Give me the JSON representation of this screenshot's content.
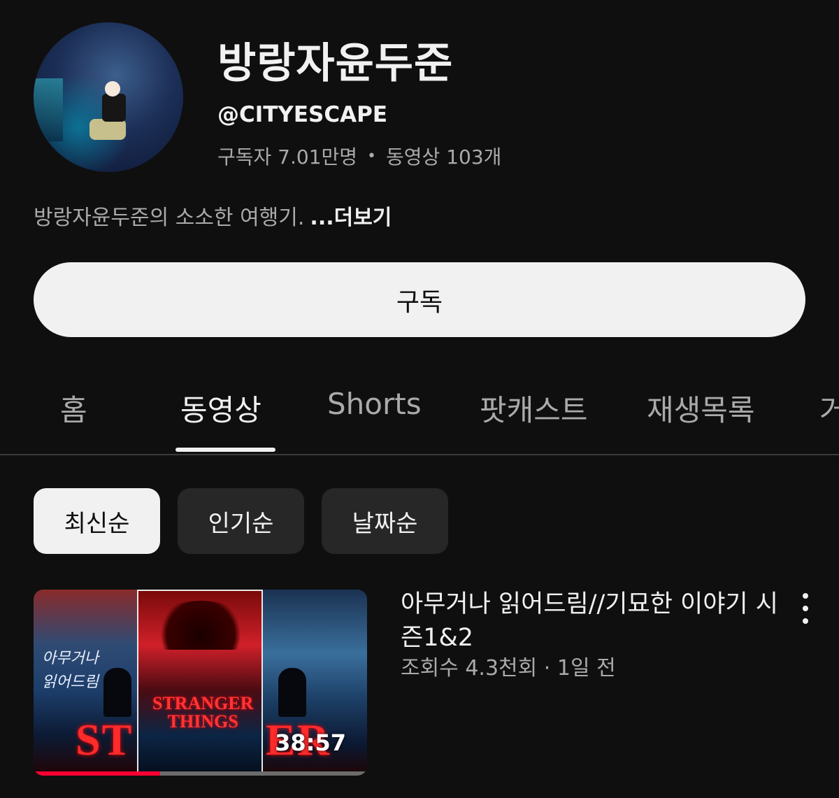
{
  "channel": {
    "name": "방랑자윤두준",
    "handle": "@CITYESCAPE",
    "subscribers": "구독자 7.01만명",
    "separator": "•",
    "video_count": "동영상 103개",
    "description": "방랑자윤두준의 소소한 여행기.",
    "more_label": "...더보기"
  },
  "subscribe_label": "구독",
  "tabs": [
    {
      "label": "홈"
    },
    {
      "label": "동영상"
    },
    {
      "label": "Shorts"
    },
    {
      "label": "팟캐스트"
    },
    {
      "label": "재생목록"
    },
    {
      "label": "거"
    }
  ],
  "active_tab": "동영상",
  "sort_chips": [
    {
      "label": "최신순"
    },
    {
      "label": "인기순"
    },
    {
      "label": "날짜순"
    }
  ],
  "active_chip": "최신순",
  "video": {
    "title": "아무거나 읽어드림//기묘한 이야기 시즌1&2",
    "meta": "조회수 4.3천회 · 1일 전",
    "duration": "38:57",
    "thumbnail_text_left": "아무거나\n읽어드림",
    "thumbnail_logo_left": "ST",
    "thumbnail_logo_mid": "STRANGER\nTHINGS",
    "thumbnail_logo_right": "ER",
    "watch_progress": 0.38,
    "progress_color": "#ff0033"
  },
  "icons": {
    "more": "kebab-menu-icon"
  }
}
